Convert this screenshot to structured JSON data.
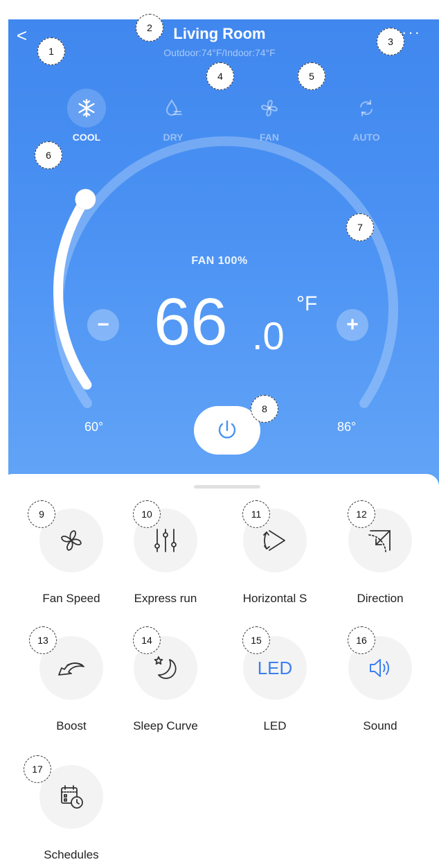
{
  "header": {
    "back_icon": "chevron-left-icon",
    "title": "Living Room",
    "subtitle": "Outdoor:74°F/Indoor:74°F",
    "more_icon": "more-horizontal-icon"
  },
  "modes": [
    {
      "label": "COOL",
      "icon": "snowflake-icon",
      "active": true
    },
    {
      "label": "DRY",
      "icon": "droplet-icon",
      "active": false
    },
    {
      "label": "FAN",
      "icon": "fan-icon",
      "active": false
    },
    {
      "label": "AUTO",
      "icon": "auto-cycle-icon",
      "active": false
    }
  ],
  "dial": {
    "fan_label": "FAN 100%",
    "temp_int": "66",
    "temp_dec": ".0",
    "unit": "°F",
    "minus": "−",
    "plus": "+",
    "min_label": "60°",
    "max_label": "86°",
    "level": 0.23
  },
  "features": [
    {
      "label": "Fan Speed",
      "icon": "fan-icon"
    },
    {
      "label": "Express run",
      "icon": "sliders-icon"
    },
    {
      "label": "Horizontal S",
      "icon": "horizontal-swing-icon"
    },
    {
      "label": "Direction",
      "icon": "direction-icon"
    },
    {
      "label": "Boost",
      "icon": "boost-icon"
    },
    {
      "label": "Sleep Curve",
      "icon": "moon-star-icon"
    },
    {
      "label": "LED",
      "icon": "led-icon",
      "icon_text": "LED"
    },
    {
      "label": "Sound",
      "icon": "speaker-icon"
    },
    {
      "label": "Schedules",
      "icon": "calendar-clock-icon"
    }
  ],
  "annotations": [
    "1",
    "2",
    "3",
    "4",
    "5",
    "6",
    "7",
    "8",
    "9",
    "10",
    "11",
    "12",
    "13",
    "14",
    "15",
    "16",
    "17"
  ],
  "colors": {
    "accent": "#3c7ff0",
    "hero_top": "#3f86ee",
    "hero_bottom": "#62a4f7",
    "feature_bg": "#f3f3f3"
  }
}
